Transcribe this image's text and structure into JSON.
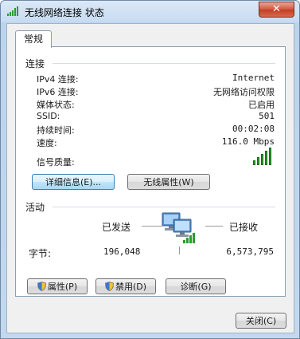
{
  "window": {
    "title": "无线网络连接 状态",
    "close_label": "✕"
  },
  "tab": {
    "label": "常规"
  },
  "connection": {
    "title": "连接",
    "rows": [
      {
        "label": "IPv4 连接:",
        "value": "Internet"
      },
      {
        "label": "IPv6 连接:",
        "value": "无网络访问权限"
      },
      {
        "label": "媒体状态:",
        "value": "已启用"
      },
      {
        "label": "SSID:",
        "value": "501"
      },
      {
        "label": "持续时间:",
        "value": "00:02:08"
      },
      {
        "label": "速度:",
        "value": "116.0 Mbps"
      }
    ],
    "signal_label": "信号质量:",
    "signal_level": "5/5",
    "details_button": "详细信息(E)...",
    "wireless_props_button": "无线属性(W)"
  },
  "activity": {
    "title": "活动",
    "sent_label": "已发送",
    "received_label": "已接收",
    "bytes_label": "字节:",
    "bytes_sent": "196,048",
    "bytes_received": "6,573,795"
  },
  "buttons": {
    "properties": "属性(P)",
    "disable": "禁用(D)",
    "diagnose": "诊断(G)",
    "close": "关闭(C)"
  },
  "colors": {
    "signal_green": "#2c9a2c",
    "title_bar": "#c7dcf2",
    "close_red": "#c23d22"
  }
}
